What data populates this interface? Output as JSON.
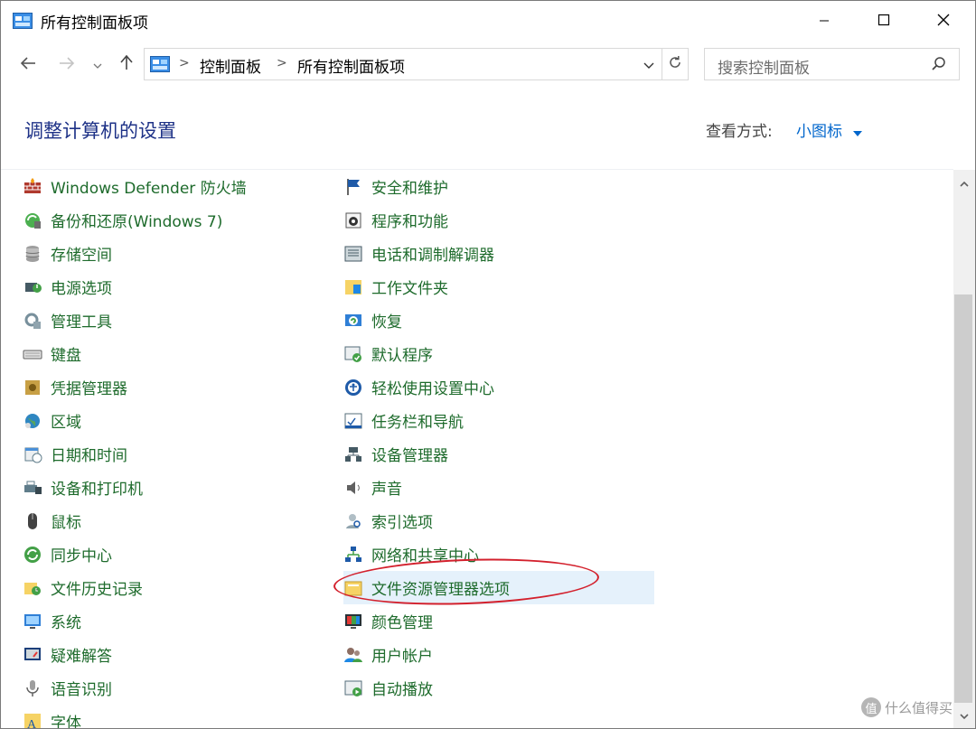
{
  "window": {
    "title": "所有控制面板项",
    "icon": "control-panel-icon"
  },
  "controls": {
    "minimize": "minimize-icon",
    "maximize": "maximize-icon",
    "close": "close-icon"
  },
  "nav": {
    "back": "arrow-left-icon",
    "forward": "arrow-right-icon",
    "recent": "chevron-down-icon",
    "up": "arrow-up-icon"
  },
  "address": {
    "crumbs": [
      "控制面板",
      "所有控制面板项"
    ],
    "sep": ">"
  },
  "search": {
    "placeholder": "搜索控制面板"
  },
  "header": {
    "title": "调整计算机的设置",
    "view_label": "查看方式:",
    "view_value": "小图标"
  },
  "items": {
    "left": [
      {
        "label": "Windows Defender 防火墙",
        "icon": "firewall-icon"
      },
      {
        "label": "备份和还原(Windows 7)",
        "icon": "backup-icon"
      },
      {
        "label": "存储空间",
        "icon": "storage-icon"
      },
      {
        "label": "电源选项",
        "icon": "power-icon"
      },
      {
        "label": "管理工具",
        "icon": "admin-tools-icon"
      },
      {
        "label": "键盘",
        "icon": "keyboard-icon"
      },
      {
        "label": "凭据管理器",
        "icon": "credential-icon"
      },
      {
        "label": "区域",
        "icon": "region-icon"
      },
      {
        "label": "日期和时间",
        "icon": "datetime-icon"
      },
      {
        "label": "设备和打印机",
        "icon": "printer-icon"
      },
      {
        "label": "鼠标",
        "icon": "mouse-icon"
      },
      {
        "label": "同步中心",
        "icon": "sync-icon"
      },
      {
        "label": "文件历史记录",
        "icon": "file-history-icon"
      },
      {
        "label": "系统",
        "icon": "system-icon"
      },
      {
        "label": "疑难解答",
        "icon": "troubleshoot-icon"
      },
      {
        "label": "语音识别",
        "icon": "microphone-icon"
      },
      {
        "label": "字体",
        "icon": "font-icon"
      }
    ],
    "right": [
      {
        "label": "安全和维护",
        "icon": "flag-icon"
      },
      {
        "label": "程序和功能",
        "icon": "programs-icon"
      },
      {
        "label": "电话和调制解调器",
        "icon": "phone-modem-icon"
      },
      {
        "label": "工作文件夹",
        "icon": "work-folders-icon"
      },
      {
        "label": "恢复",
        "icon": "recovery-icon"
      },
      {
        "label": "默认程序",
        "icon": "default-programs-icon"
      },
      {
        "label": "轻松使用设置中心",
        "icon": "ease-of-access-icon"
      },
      {
        "label": "任务栏和导航",
        "icon": "taskbar-icon"
      },
      {
        "label": "设备管理器",
        "icon": "device-manager-icon"
      },
      {
        "label": "声音",
        "icon": "speaker-icon"
      },
      {
        "label": "索引选项",
        "icon": "indexing-icon"
      },
      {
        "label": "网络和共享中心",
        "icon": "network-icon"
      },
      {
        "label": "文件资源管理器选项",
        "icon": "folder-options-icon",
        "highlighted": true
      },
      {
        "label": "颜色管理",
        "icon": "color-management-icon"
      },
      {
        "label": "用户帐户",
        "icon": "user-accounts-icon"
      },
      {
        "label": "自动播放",
        "icon": "autoplay-icon"
      }
    ]
  },
  "watermark": {
    "text": "什么值得买",
    "logo": "值"
  },
  "colors": {
    "link_green": "#1e6b2c",
    "title_blue": "#1e3287",
    "accent_blue": "#0066cc",
    "annotation_red": "#d3202c",
    "highlight": "#e5f1fb"
  }
}
